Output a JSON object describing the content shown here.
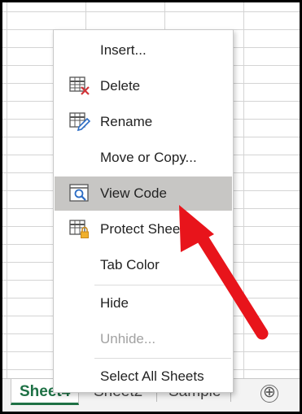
{
  "sheet_tabs": [
    {
      "label": "Sheet4",
      "active": true
    },
    {
      "label": "Sheet2",
      "active": false
    },
    {
      "label": "Sample",
      "active": false
    }
  ],
  "add_sheet_symbol": "⊕",
  "context_menu": {
    "items": [
      {
        "label": "Insert...",
        "icon": "none",
        "disabled": false
      },
      {
        "label": "Delete",
        "icon": "delete-sheet-icon",
        "disabled": false
      },
      {
        "label": "Rename",
        "icon": "rename-sheet-icon",
        "disabled": false
      },
      {
        "label": "Move or Copy...",
        "icon": "none",
        "disabled": false
      },
      {
        "label": "View Code",
        "icon": "view-code-icon",
        "disabled": false,
        "highlighted": true
      },
      {
        "label": "Protect Sheet",
        "icon": "protect-sheet-icon",
        "disabled": false
      },
      {
        "label": "Tab Color",
        "icon": "none",
        "disabled": false
      },
      {
        "label": "Hide",
        "icon": "none",
        "disabled": false
      },
      {
        "label": "Unhide...",
        "icon": "none",
        "disabled": true
      },
      {
        "label": "Select All Sheets",
        "icon": "none",
        "disabled": false
      }
    ]
  },
  "colors": {
    "active_tab": "#1e7145",
    "highlight": "#c7c6c4",
    "arrow": "#e8141b",
    "disabled_text": "#a2a2a2"
  }
}
